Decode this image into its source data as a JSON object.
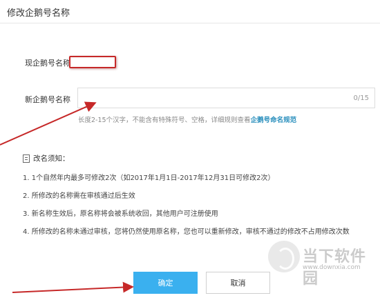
{
  "dialog": {
    "title": "修改企鹅号名称"
  },
  "current_name": {
    "label": "现企鹅号名称"
  },
  "new_name": {
    "label": "新企鹅号名称",
    "value": "",
    "placeholder": "",
    "counter": "0/15",
    "hint_text": "长度2-15个汉字，不能含有特殊符号、空格，详细规则查看",
    "hint_link": "企鹅号命名规范"
  },
  "notice": {
    "title": "改名须知：",
    "items": [
      "1. 1个自然年内最多可修改2次（如2017年1月1日-2017年12月31日可修改2次）",
      "2. 所修改的名称需在审核通过后生效",
      "3. 新名称生效后，原名称将会被系统收回，其他用户可注册使用",
      "4. 所修改的名称未通过审核，您将仍然使用原名称，您也可以重新修改，审核不通过的修改不占用修改次数"
    ]
  },
  "buttons": {
    "confirm": "确定",
    "cancel": "取消"
  },
  "watermark": {
    "brand": "当下软件园",
    "url": "www.downxia.com"
  },
  "colors": {
    "primary": "#3ab0ef",
    "link": "#2a8fbd",
    "annotation": "#c62828"
  }
}
